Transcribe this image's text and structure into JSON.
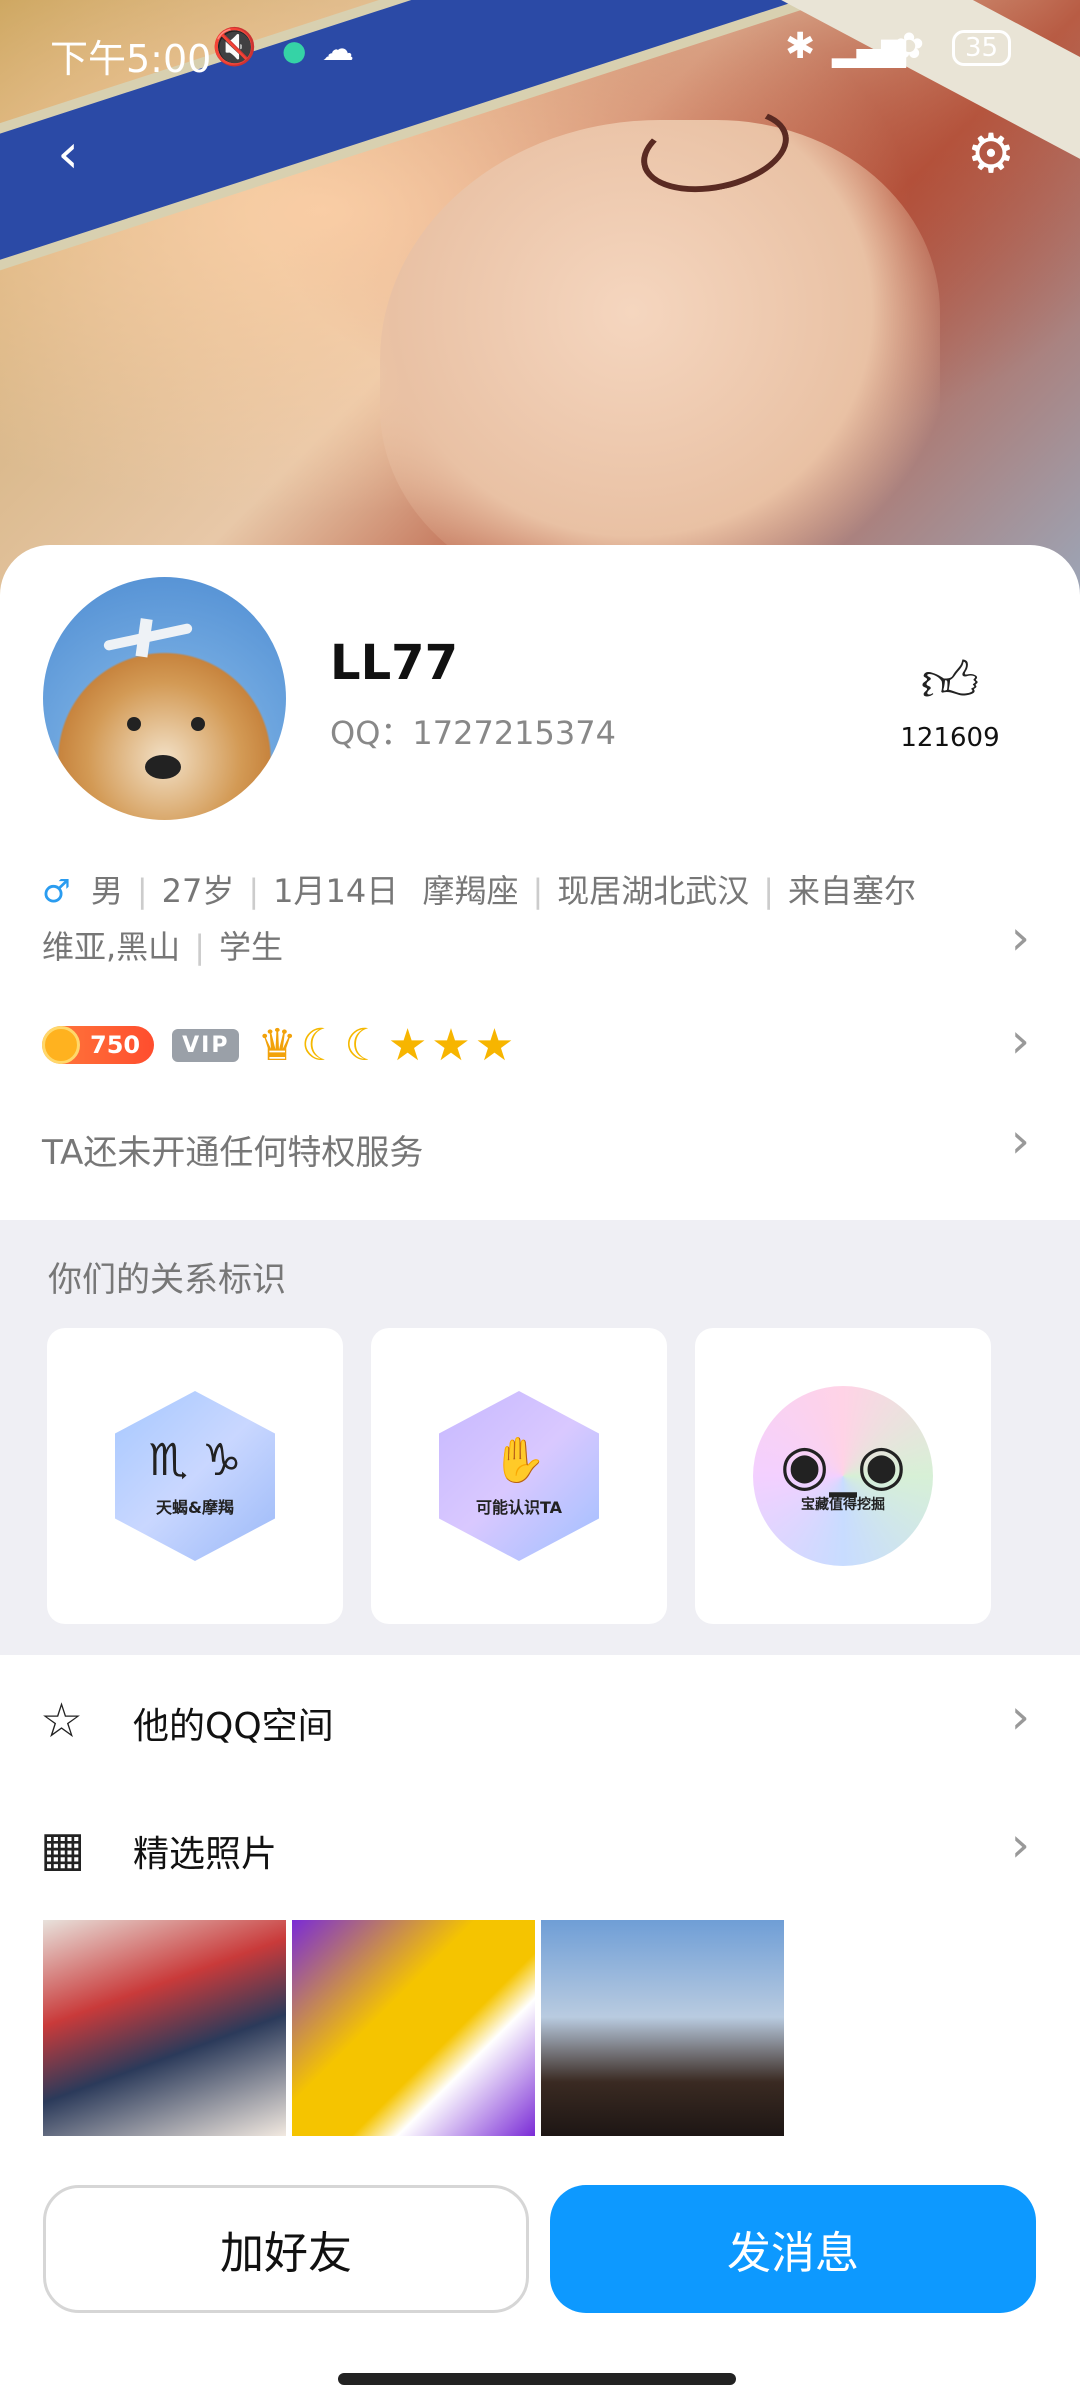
{
  "status_bar": {
    "time": "下午5:00",
    "battery": "35",
    "icons": [
      "mute-icon",
      "dot-icon",
      "cloud-icon",
      "bluetooth-icon",
      "signal-icon",
      "hotspot-icon",
      "battery-icon"
    ]
  },
  "nav": {
    "back_icon": "back-icon",
    "settings_icon": "gear-icon"
  },
  "profile": {
    "nickname": "LL77",
    "qq": "QQ：1727215374",
    "likes": "121609",
    "gender_symbol": "♂",
    "gender": "男",
    "age": "27岁",
    "birthday": "1月14日",
    "zodiac": "摩羯座",
    "residence": "现居湖北武汉",
    "hometown": "来自塞尔维亚,黑山",
    "occupation": "学生"
  },
  "badges": {
    "coin_value": "750",
    "vip_label": "VIP"
  },
  "privilege_text": "TA还未开通任何特权服务",
  "relationship": {
    "title": "你们的关系标识",
    "cards": [
      {
        "label": "天蝎&摩羯",
        "glyphs": "♏ ♑"
      },
      {
        "label": "可能认识TA",
        "glyphs": "✋"
      },
      {
        "label": "宝藏值得挖掘",
        "glyphs": "◉_◉"
      }
    ]
  },
  "menu": {
    "qzone": "他的QQ空间",
    "photos": "精选照片"
  },
  "actions": {
    "add_friend": "加好友",
    "send_message": "发消息"
  },
  "colors": {
    "accent_blue": "#0d99ff",
    "male_blue": "#2a9cf0"
  }
}
